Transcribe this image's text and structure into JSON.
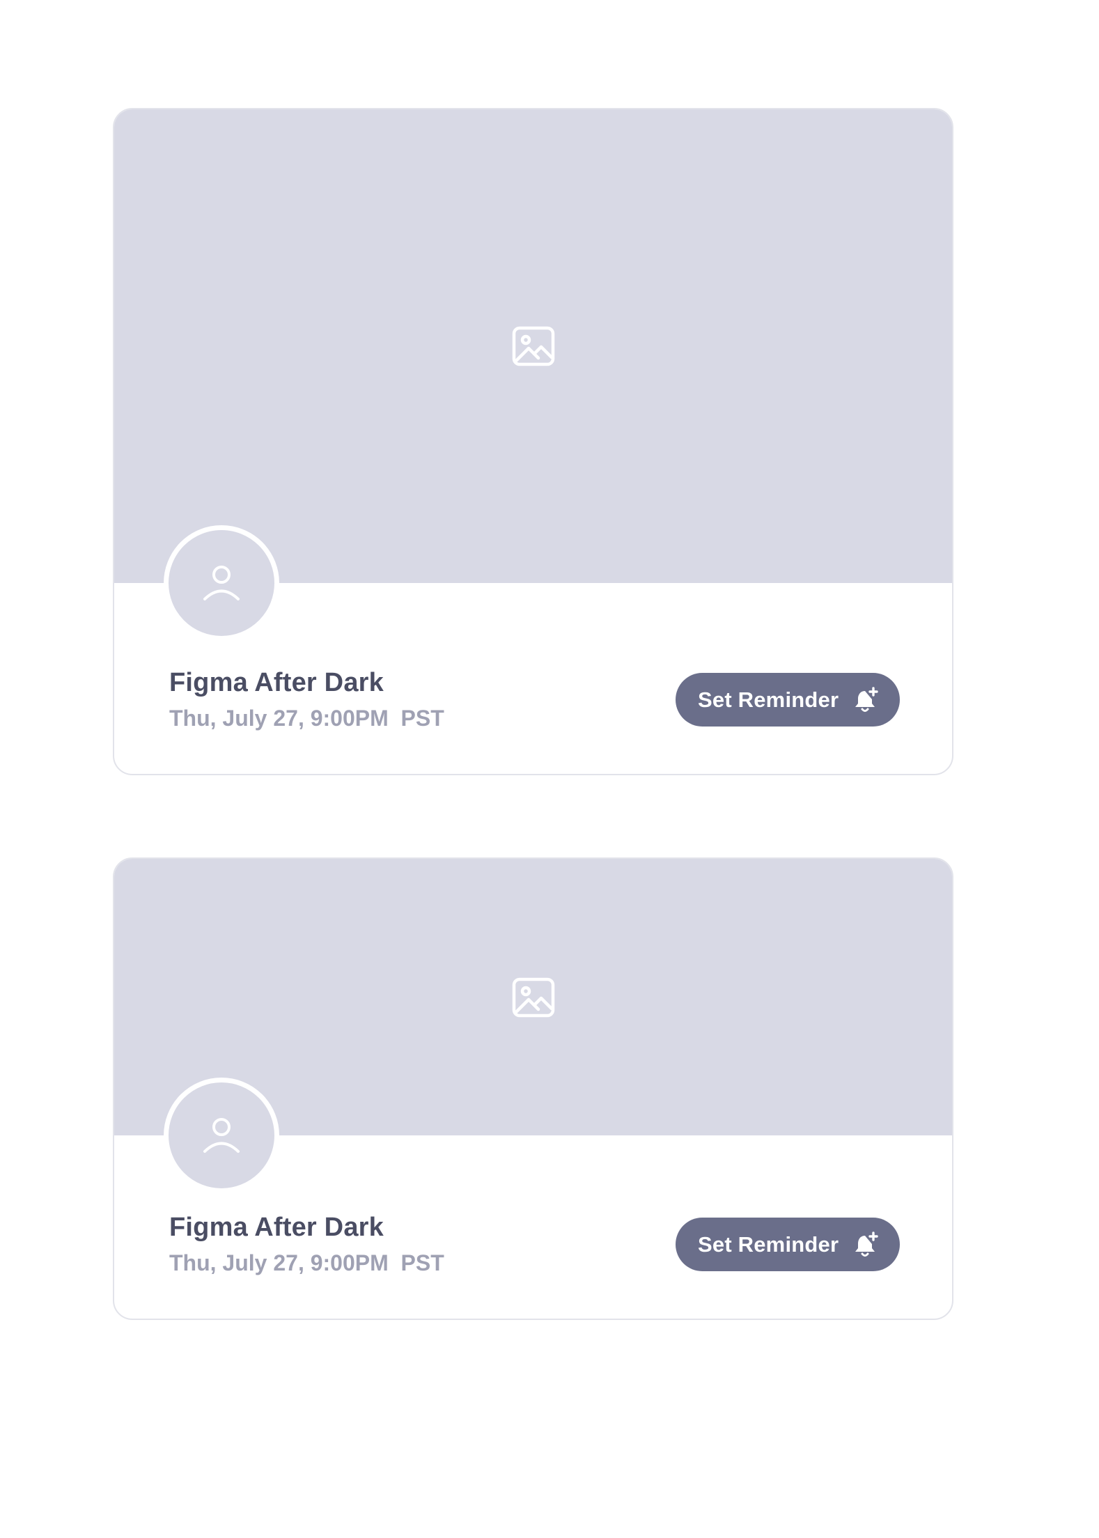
{
  "cards": [
    {
      "banner_icon": "image-placeholder-icon",
      "avatar_icon": "user-icon",
      "title": "Figma After Dark",
      "subtitle": "Thu, July 27, 9:00PM  PST",
      "button": {
        "label": "Set Reminder",
        "icon": "bell-plus-icon"
      }
    },
    {
      "banner_icon": "image-placeholder-icon",
      "avatar_icon": "user-icon",
      "title": "Figma After Dark",
      "subtitle": "Thu, July 27, 9:00PM  PST",
      "button": {
        "label": "Set Reminder",
        "icon": "bell-plus-icon"
      }
    }
  ],
  "colors": {
    "placeholder": "#d8d9e5",
    "button": "#6a6e8a",
    "title": "#4a4d63",
    "subtitle": "#9fa1b3",
    "card_border": "#e2e3ea"
  }
}
